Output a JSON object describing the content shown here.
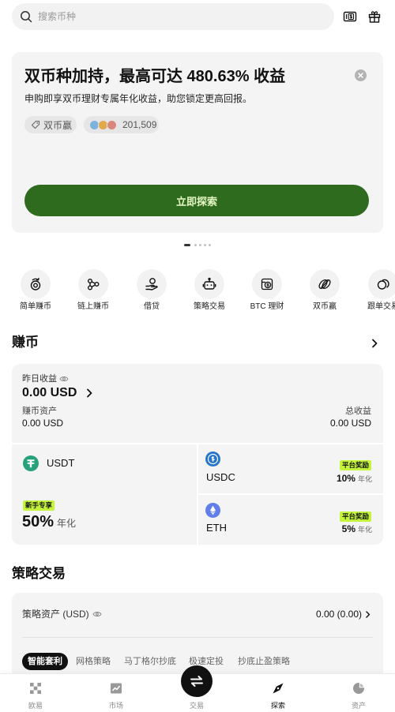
{
  "search": {
    "placeholder": "搜索币种",
    "icon": "search-icon"
  },
  "header_icons": [
    "coupon-icon",
    "gift-icon"
  ],
  "banner": {
    "title": "双币种加持，最高可达 480.63% 收益",
    "subtitle": "申购即享双币理财专属年化收益，助您锁定更高回报。",
    "tag_label": "双币赢",
    "participants": "201,509",
    "cta_label": "立即探索",
    "cta_color": "#2f6b1f"
  },
  "carousel": {
    "count": 5,
    "active_index": 0
  },
  "shortcuts": [
    {
      "label": "简单赚币",
      "icon": "coin-cycle-icon"
    },
    {
      "label": "链上赚币",
      "icon": "chain-nodes-icon"
    },
    {
      "label": "借贷",
      "icon": "hand-coin-icon"
    },
    {
      "label": "策略交易",
      "icon": "robot-icon"
    },
    {
      "label": "BTC 理财",
      "icon": "btc-box-icon"
    },
    {
      "label": "双币赢",
      "icon": "dual-coin-icon"
    },
    {
      "label": "跟单交易",
      "icon": "copy-trade-icon"
    }
  ],
  "earn": {
    "section_title": "赚币",
    "yesterday_label": "昨日收益",
    "yesterday_value": "0.00 USD",
    "assets_label": "赚币资产",
    "assets_value": "0.00 USD",
    "total_label": "总收益",
    "total_value": "0.00 USD",
    "badge_color": "#c4f53a",
    "products": [
      {
        "coin": "USDT",
        "badge": "新手专享",
        "rate": "50%",
        "rate_unit": "年化",
        "color": "#26a17b"
      },
      {
        "coin": "USDC",
        "badge": "平台奖励",
        "rate": "10%",
        "rate_unit": "年化",
        "color": "#2775ca"
      },
      {
        "coin": "ETH",
        "badge": "平台奖励",
        "rate": "5%",
        "rate_unit": "年化",
        "color": "#627eea"
      }
    ]
  },
  "strategy": {
    "section_title": "策略交易",
    "assets_label": "策略资产 (USD)",
    "assets_value": "0.00 (0.00)",
    "tabs": [
      {
        "label": "智能套利",
        "active": true
      },
      {
        "label": "网格策略",
        "active": false
      },
      {
        "label": "马丁格尔抄底",
        "active": false
      },
      {
        "label": "极速定投",
        "active": false
      },
      {
        "label": "抄底止盈策略",
        "active": false
      }
    ]
  },
  "nav": [
    {
      "label": "欧易",
      "icon": "okx-logo-icon",
      "active": false
    },
    {
      "label": "市场",
      "icon": "market-chart-icon",
      "active": false
    },
    {
      "label": "交易",
      "icon": "exchange-arrows-icon",
      "active": false
    },
    {
      "label": "探索",
      "icon": "compass-icon",
      "active": true
    },
    {
      "label": "资产",
      "icon": "pie-chart-icon",
      "active": false
    }
  ]
}
